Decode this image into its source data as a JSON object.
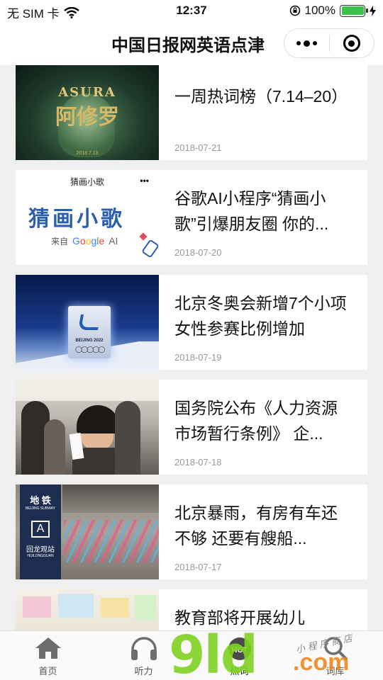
{
  "status_bar": {
    "carrier": "无 SIM 卡",
    "time": "12:37",
    "battery": "100%"
  },
  "nav": {
    "title": "中国日报网英语点津"
  },
  "articles": [
    {
      "title": "一周热词榜（7.14–20）",
      "date": "2018-07-21"
    },
    {
      "title": "谷歌AI小程序“猜画小歌”引爆朋友圈 你的...",
      "date": "2018-07-20"
    },
    {
      "title": "北京冬奥会新增7个小项 女性参赛比例增加",
      "date": "2018-07-19"
    },
    {
      "title": "国务院公布《人力资源市场暂行条例》 企...",
      "date": "2018-07-18"
    },
    {
      "title": "北京暴雨，有房有车还不够 还要有艘船...",
      "date": "2018-07-17"
    },
    {
      "title": "教育部将开展幼儿",
      "date": ""
    }
  ],
  "thumbs": {
    "asura_text": "ASURA",
    "asura_cn": "阿修罗",
    "asura_date": "2018.7.13",
    "guess_header": "猜画小歌",
    "guess_title": "猜画小歌",
    "guess_from": "来自",
    "google": "Google",
    "google_ai": "AI",
    "beijing": "BEIJING 2022",
    "subway_line1": "地 铁",
    "subway_line2": "BEIJING SUBWAY",
    "station_letter": "A",
    "station_name": "回龙观站",
    "station_en": "HUILONGGUAN"
  },
  "tabs": [
    {
      "label": "首页",
      "icon": "home-icon"
    },
    {
      "label": "听力",
      "icon": "headphones-icon"
    },
    {
      "label": "热词",
      "icon": "hot-icon",
      "badge": "HOT"
    },
    {
      "label": "词库",
      "icon": "search-icon"
    }
  ],
  "watermark": {
    "brand": "9ld",
    "suffix": ".com",
    "small": "小程序商店"
  }
}
